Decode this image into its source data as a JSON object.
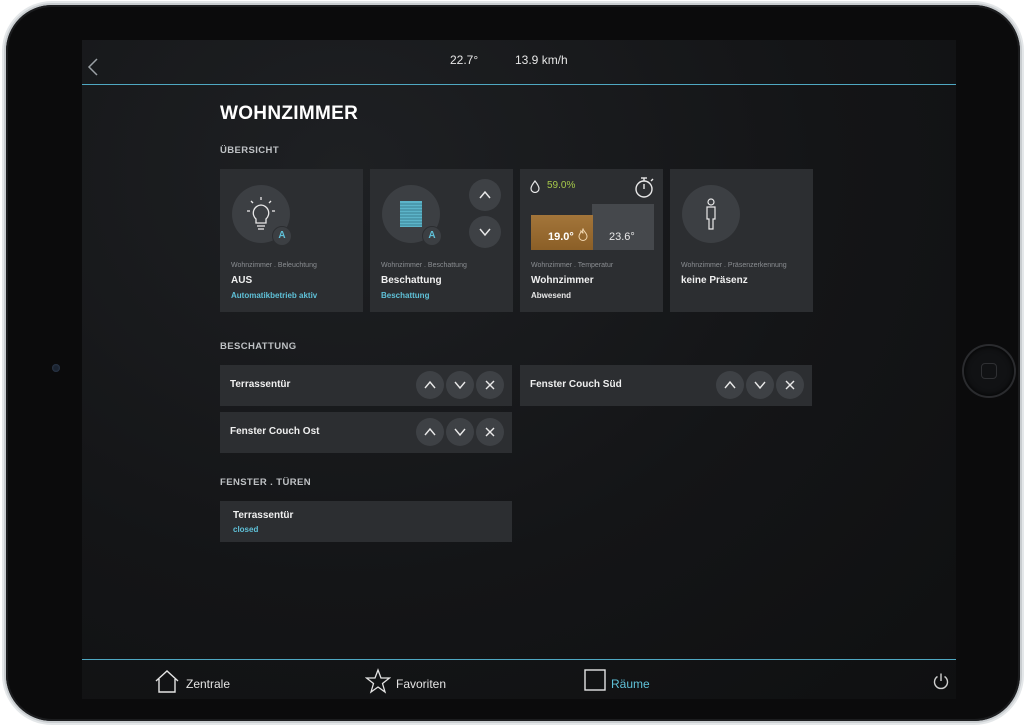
{
  "status": {
    "temperature": "22.7°",
    "wind": "13.9 km/h"
  },
  "room": {
    "title": "WOHNZIMMER"
  },
  "sections": {
    "overview": "ÜBERSICHT",
    "shading": "BESCHATTUNG",
    "windows_doors": "FENSTER . TÜREN"
  },
  "tiles": {
    "lighting": {
      "category": "Wohnzimmer . Beleuchtung",
      "value": "AUS",
      "status": "Automatikbetrieb aktiv",
      "badge": "A",
      "icon": "lightbulb-icon"
    },
    "shading": {
      "category": "Wohnzimmer . Beschattung",
      "value": "Beschattung",
      "status": "Beschattung",
      "badge": "A",
      "icon": "blinds-icon"
    },
    "temperature": {
      "humidity": "59.0%",
      "setpoint": "19.0°",
      "current": "23.6°",
      "category": "Wohnzimmer . Temperatur",
      "value": "Wohnzimmer",
      "status": "Abwesend"
    },
    "presence": {
      "category": "Wohnzimmer . Präsenzerkennung",
      "value": "keine Präsenz",
      "icon": "person-icon"
    }
  },
  "shading_rows": [
    {
      "name": "Terrassentür"
    },
    {
      "name": "Fenster Couch Süd"
    },
    {
      "name": "Fenster Couch Ost"
    }
  ],
  "doors": [
    {
      "name": "Terrassentür",
      "state": "closed"
    }
  ],
  "nav": {
    "central": "Zentrale",
    "favorites": "Favoriten",
    "rooms": "Räume"
  },
  "colors": {
    "accent": "#5fc1d8",
    "tile": "#2c2e31",
    "humidity": "#a6c84a",
    "heating": "#a3753a"
  }
}
